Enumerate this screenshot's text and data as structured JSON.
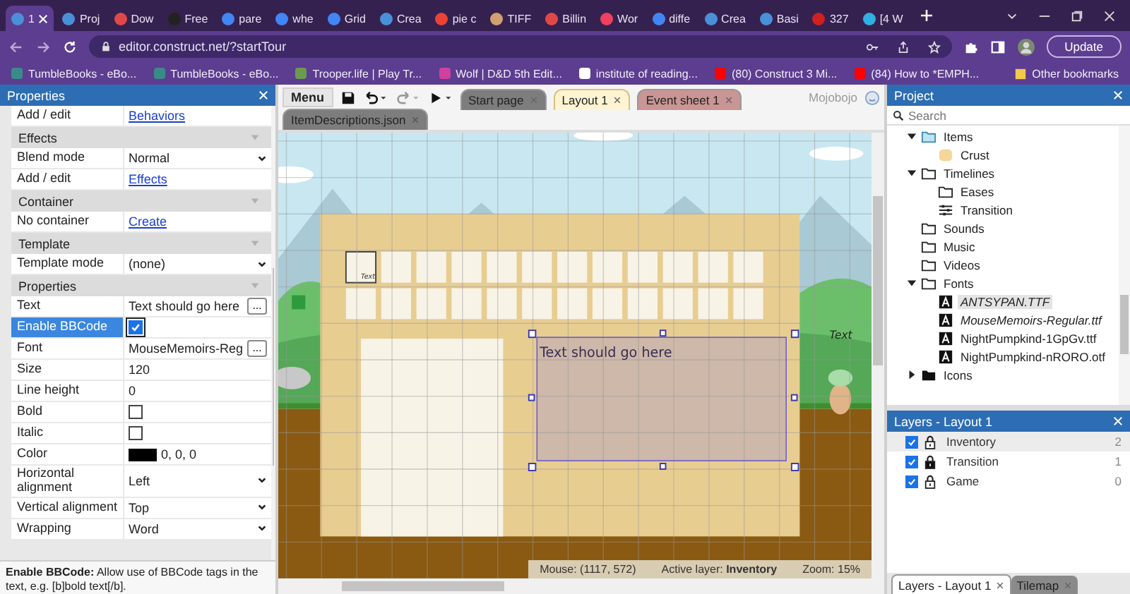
{
  "browser": {
    "tabs": [
      {
        "title": "1",
        "selected": true,
        "color": "#4a90d9"
      },
      {
        "title": "Proj",
        "selected": false,
        "color": "#4a90d9"
      },
      {
        "title": "Dow",
        "selected": false,
        "color": "#e04848"
      },
      {
        "title": "Free",
        "selected": false,
        "color": "#222222"
      },
      {
        "title": "pare",
        "selected": false,
        "color": "#4285f4"
      },
      {
        "title": "whe",
        "selected": false,
        "color": "#4285f4"
      },
      {
        "title": "Grid",
        "selected": false,
        "color": "#4285f4"
      },
      {
        "title": "Crea",
        "selected": false,
        "color": "#4a90d9"
      },
      {
        "title": "pie c",
        "selected": false,
        "color": "#ea4335"
      },
      {
        "title": "TIFF",
        "selected": false,
        "color": "#d0a070"
      },
      {
        "title": "Billin",
        "selected": false,
        "color": "#e04848"
      },
      {
        "title": "Wor",
        "selected": false,
        "color": "#f04060"
      },
      {
        "title": "diffe",
        "selected": false,
        "color": "#4285f4"
      },
      {
        "title": "Crea",
        "selected": false,
        "color": "#4a90d9"
      },
      {
        "title": "Basi",
        "selected": false,
        "color": "#4a90d9"
      },
      {
        "title": "327",
        "selected": false,
        "color": "#d02020"
      },
      {
        "title": "[4 W",
        "selected": false,
        "color": "#30b0e0"
      }
    ],
    "address": "editor.construct.net/?startTour",
    "update_button": "Update",
    "bookmarks": [
      {
        "label": "TumbleBooks - eBo...",
        "color": "#3a8a8a"
      },
      {
        "label": "TumbleBooks - eBo...",
        "color": "#3a8a8a"
      },
      {
        "label": "Trooper.life | Play Tr...",
        "color": "#6a9a50"
      },
      {
        "label": "Wolf | D&D 5th Edit...",
        "color": "#d040a0"
      },
      {
        "label": "institute of reading...",
        "color": "#ffffff"
      },
      {
        "label": "(80) Construct 3 Mi...",
        "color": "#ff0000"
      },
      {
        "label": "(84) How to *EMPH...",
        "color": "#ff0000"
      }
    ],
    "other_bookmarks": "Other bookmarks"
  },
  "properties_panel": {
    "title": "Properties",
    "rows": [
      {
        "kind": "link",
        "label": "Add / edit",
        "value": "Behaviors",
        "selected": false
      },
      {
        "kind": "section",
        "label": "Effects",
        "selected": false
      },
      {
        "kind": "select",
        "label": "Blend mode",
        "value": "Normal",
        "selected": false
      },
      {
        "kind": "link",
        "label": "Add / edit",
        "value": "Effects",
        "selected": false
      },
      {
        "kind": "section",
        "label": "Container",
        "selected": false
      },
      {
        "kind": "link",
        "label": "No container",
        "value": "Create",
        "selected": false
      },
      {
        "kind": "section",
        "label": "Template",
        "selected": false
      },
      {
        "kind": "select",
        "label": "Template mode",
        "value": "(none)",
        "selected": false
      },
      {
        "kind": "section",
        "label": "Properties",
        "selected": false
      },
      {
        "kind": "button",
        "label": "Text",
        "value": "Text should go here",
        "button": "...",
        "selected": false
      },
      {
        "kind": "checkbox",
        "label": "Enable BBCode",
        "checked": true,
        "selected": true
      },
      {
        "kind": "button",
        "label": "Font",
        "value": "MouseMemoirs-Reg",
        "button": "...",
        "selected": false
      },
      {
        "kind": "text",
        "label": "Size",
        "value": "120",
        "selected": false
      },
      {
        "kind": "text",
        "label": "Line height",
        "value": "0",
        "selected": false
      },
      {
        "kind": "checkbox",
        "label": "Bold",
        "checked": false,
        "selected": false
      },
      {
        "kind": "checkbox",
        "label": "Italic",
        "checked": false,
        "selected": false
      },
      {
        "kind": "color",
        "label": "Color",
        "color": "#000000",
        "value": "0, 0, 0",
        "selected": false
      },
      {
        "kind": "select",
        "label": "Horizontal alignment",
        "value": "Left",
        "selected": false
      },
      {
        "kind": "select",
        "label": "Vertical alignment",
        "value": "Top",
        "selected": false
      },
      {
        "kind": "select",
        "label": "Wrapping",
        "value": "Word",
        "selected": false
      }
    ],
    "help": "**Enable BBCode:** Allow use of BBCode tags in the text, e.g. [b]bold text[/b]."
  },
  "editor": {
    "menu_button": "Menu",
    "tabs": [
      {
        "label": "Start page",
        "color": "#7d7d7d",
        "selected": false
      },
      {
        "label": "Layout 1",
        "color": "#fff4d2",
        "selected": true
      },
      {
        "label": "Event sheet 1",
        "color": "#c99595",
        "selected": false
      }
    ],
    "file_tabs": [
      {
        "label": "ItemDescriptions.json",
        "color": "#7d7d7d",
        "selected": false
      }
    ],
    "user": "Mojobojo",
    "canvas": {
      "slot_text": "Text",
      "text_object": "Text should go here",
      "side_text": "Text"
    },
    "status": {
      "mouse": "Mouse: (1117, 572)",
      "active_layer": "Active layer: **Inventory**",
      "zoom": "Zoom: 15%"
    }
  },
  "project_panel": {
    "title": "Project",
    "search": {
      "placeholder": "Search"
    },
    "tree": [
      {
        "label": "Items",
        "kind": "image-folder",
        "expanded": true,
        "selected": false,
        "children": [
          {
            "label": "Crust",
            "kind": "sprite",
            "selected": false
          }
        ]
      },
      {
        "label": "Timelines",
        "kind": "folder",
        "expanded": true,
        "selected": false,
        "children": [
          {
            "label": "Eases",
            "kind": "folder",
            "selected": false
          },
          {
            "label": "Transition",
            "kind": "timeline",
            "selected": false
          }
        ]
      },
      {
        "label": "Sounds",
        "kind": "folder",
        "selected": false
      },
      {
        "label": "Music",
        "kind": "folder",
        "selected": false
      },
      {
        "label": "Videos",
        "kind": "folder",
        "selected": false
      },
      {
        "label": "Fonts",
        "kind": "folder",
        "expanded": true,
        "selected": false,
        "children": [
          {
            "label": "ANTSYPAN.TTF",
            "kind": "font",
            "italic": true,
            "selected": true
          },
          {
            "label": "MouseMemoirs-Regular.ttf",
            "kind": "font",
            "italic": true,
            "selected": false
          },
          {
            "label": "NightPumpkind-1GpGv.ttf",
            "kind": "font",
            "italic": false,
            "selected": false
          },
          {
            "label": "NightPumpkind-nRORO.otf",
            "kind": "font",
            "italic": false,
            "selected": false
          }
        ]
      },
      {
        "label": "Icons",
        "kind": "dark-folder",
        "expanded": false,
        "selected": false
      }
    ]
  },
  "layers_panel": {
    "title": "Layers - Layout 1",
    "layers": [
      {
        "name": "Inventory",
        "count": "2",
        "visible": true,
        "locked": false,
        "selected": true
      },
      {
        "name": "Transition",
        "count": "1",
        "visible": true,
        "locked": true,
        "selected": false
      },
      {
        "name": "Game",
        "count": "0",
        "visible": true,
        "locked": false,
        "selected": false
      }
    ],
    "tabs": [
      {
        "label": "Layers - Layout 1",
        "selected": true
      },
      {
        "label": "Tilemap",
        "selected": false
      }
    ]
  }
}
